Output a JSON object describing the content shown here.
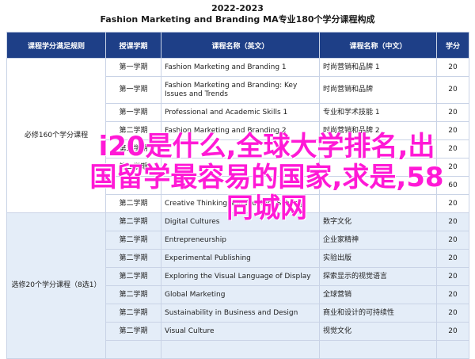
{
  "title_line1": "2022-2023",
  "title_line2": "Fashion Marketing and Branding MA专业180个学分课程构成",
  "columns": [
    "课程学分满足规则",
    "授课学期",
    "课程名称（英文）",
    "课程名称（中文）",
    "学分"
  ],
  "blocks": [
    {
      "label": "必修160个学分课程",
      "rows": 8
    },
    {
      "label": "选修20个学分课程（8选1）",
      "rows": 8
    }
  ],
  "rows": [
    {
      "semester": "第一学期",
      "en": "Fashion Marketing and Branding 1",
      "cn": "时尚营销和品牌 1",
      "credit": "20"
    },
    {
      "semester": "第一学期",
      "en": "Fashion Marketing and Branding: Key Issues and Trends",
      "cn": "时尚营销和品牌",
      "credit": "20"
    },
    {
      "semester": "第一学期",
      "en": "Professional and Academic Skills 1",
      "cn": "专业和学术技能 1",
      "credit": "20"
    },
    {
      "semester": "第二学期",
      "en": "Fashion Marketing and Branding 2",
      "cn": "时尚营销和品牌 2",
      "credit": "20"
    },
    {
      "semester": "第二学期",
      "en": "",
      "cn": "",
      "credit": "20"
    },
    {
      "semester": "第二学期",
      "en": "",
      "cn": "",
      "credit": "20"
    },
    {
      "semester": "",
      "en": "",
      "cn": "",
      "credit": "60"
    },
    {
      "semester": "第二学期",
      "en": "Creative Thinking and Problem Solving",
      "cn": "",
      "credit": "20"
    },
    {
      "semester": "第二学期",
      "en": "Digital Cultures",
      "cn": "数字文化",
      "credit": "20"
    },
    {
      "semester": "第二学期",
      "en": "Entrepreneurship",
      "cn": "企业家精神",
      "credit": "20"
    },
    {
      "semester": "第二学期",
      "en": "Experimental Publishing",
      "cn": "实验出版",
      "credit": "20"
    },
    {
      "semester": "第二学期",
      "en": "Exploring the Visual Language of Display",
      "cn": "探索显示的视觉语言",
      "credit": "20"
    },
    {
      "semester": "第二学期",
      "en": "Global Marketing",
      "cn": "全球营销",
      "credit": "20"
    },
    {
      "semester": "第二学期",
      "en": "Sustainability in Business and Design",
      "cn": "商业和设计的可持续性",
      "credit": "20"
    },
    {
      "semester": "第二学期",
      "en": "Visual Culture",
      "cn": "视觉文化",
      "credit": "20"
    }
  ],
  "overlay_text": "i20是什么,全球大学排名,出国留学最容易的国家,求是,58同城网"
}
